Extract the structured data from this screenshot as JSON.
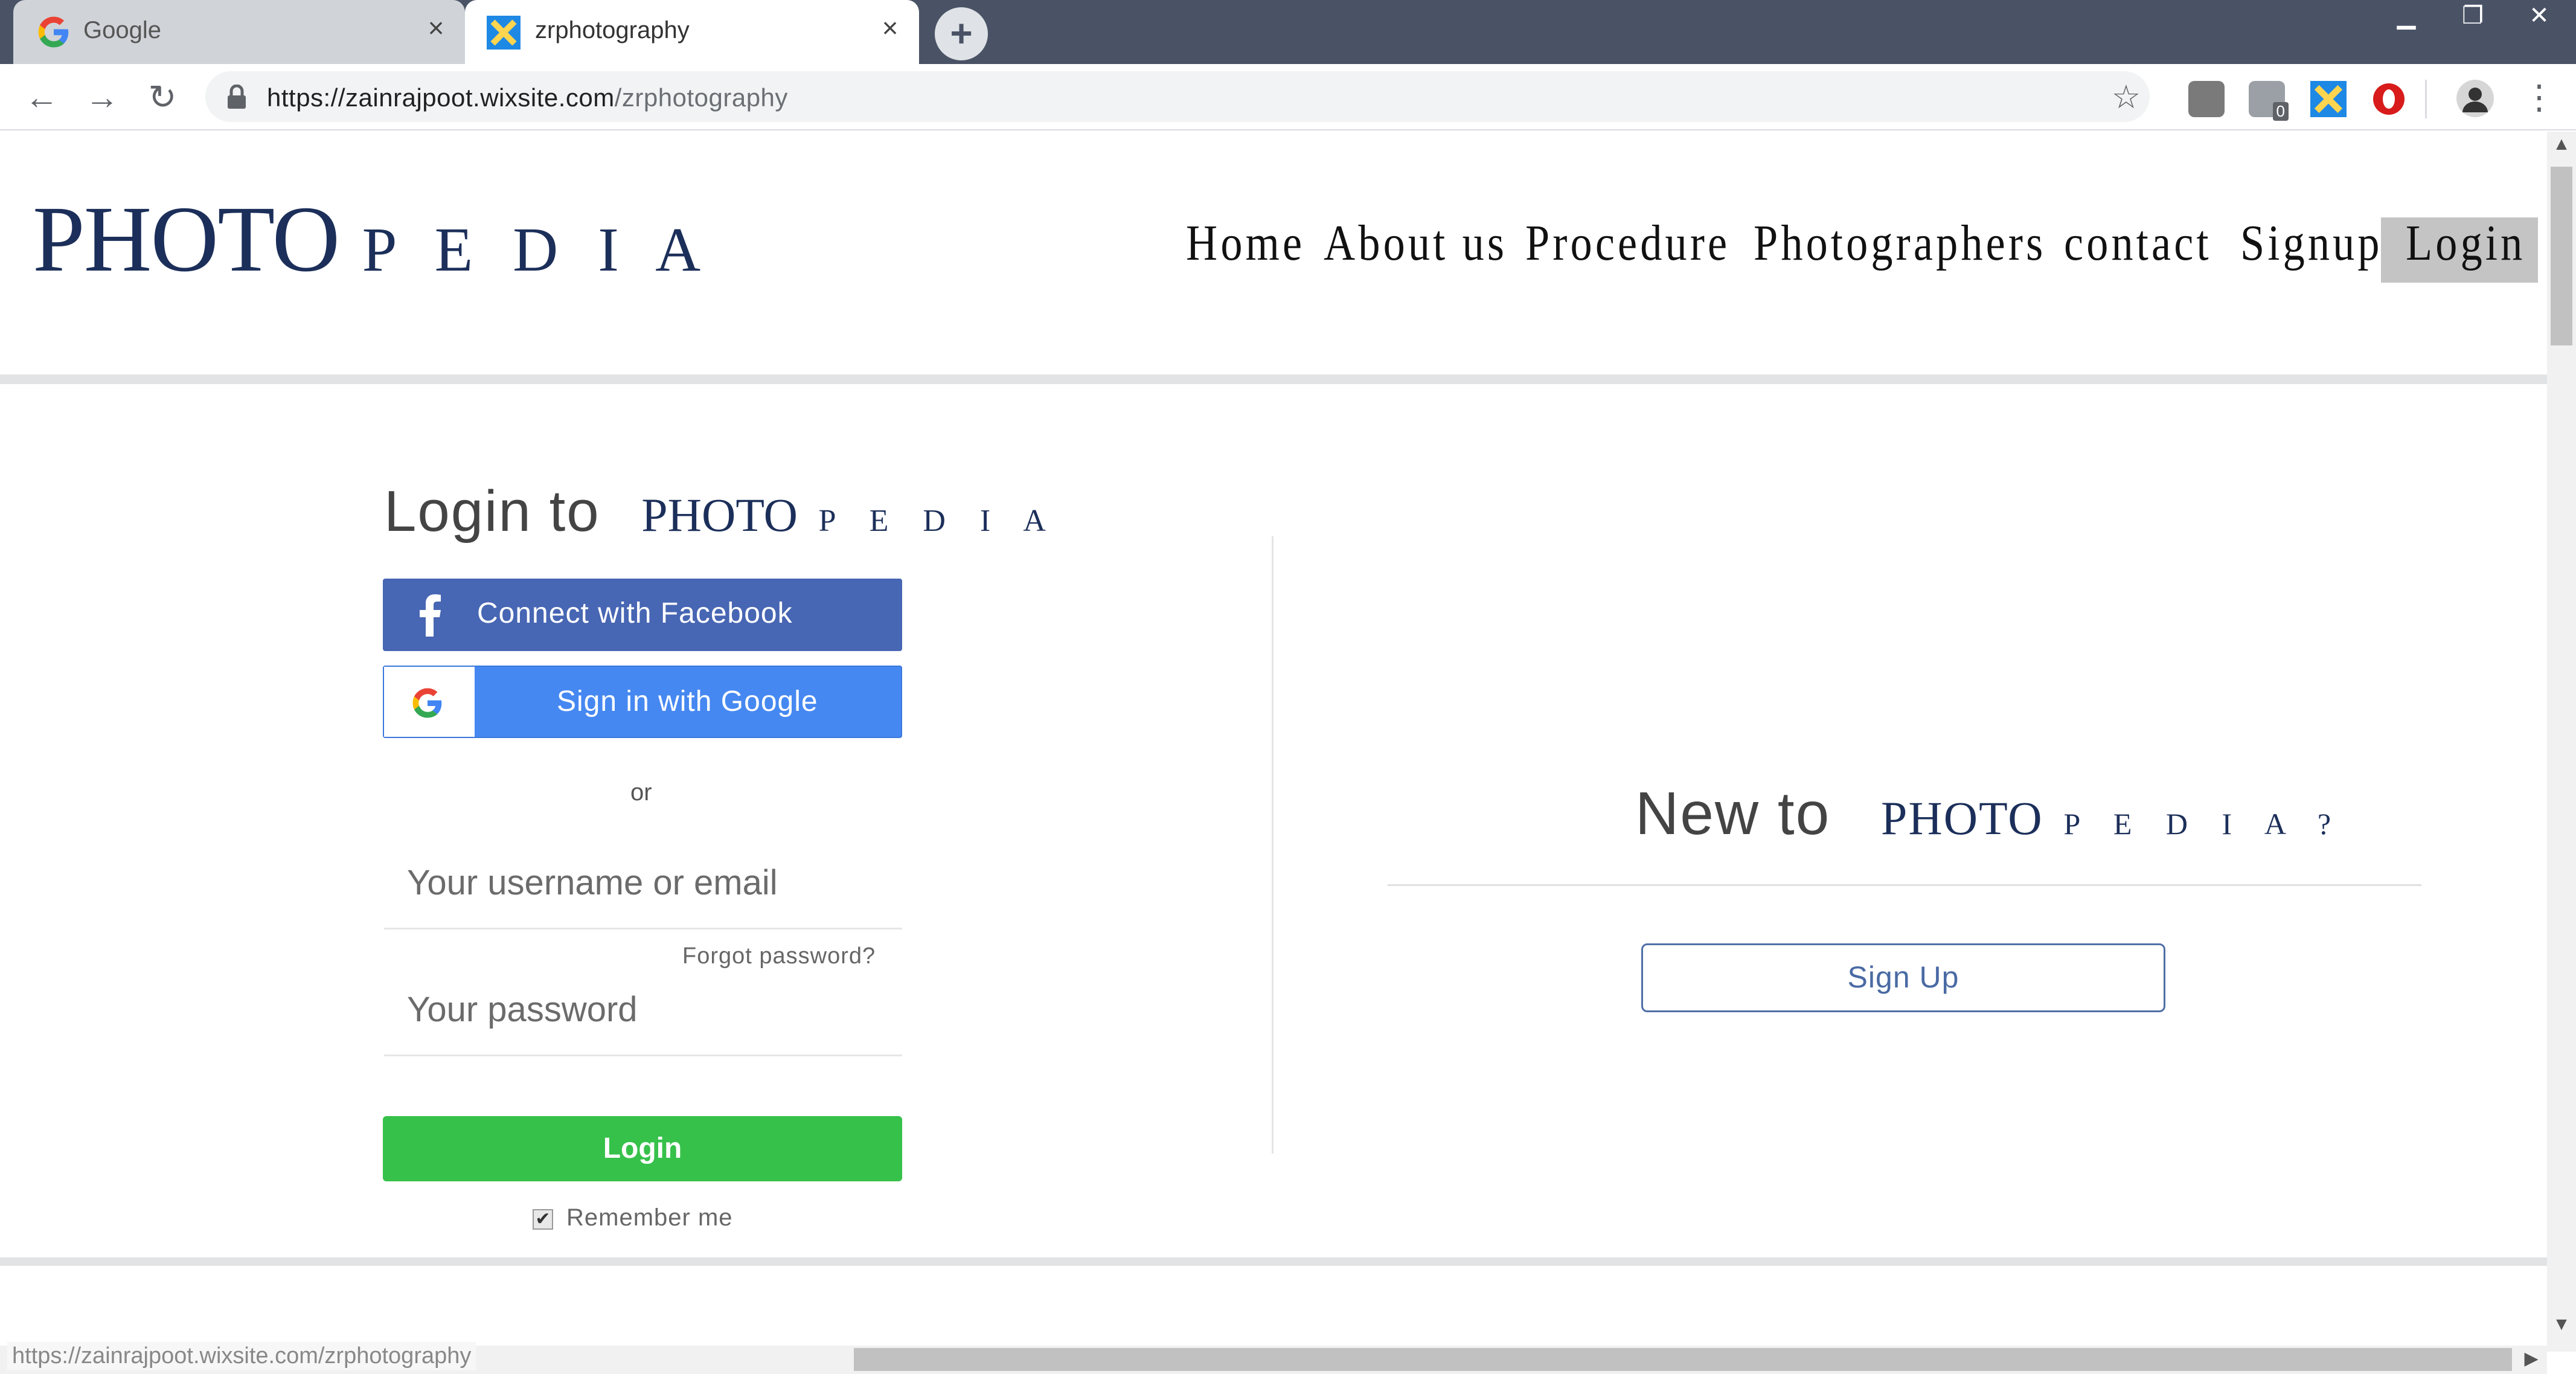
{
  "browser": {
    "tabs": [
      {
        "title": "Google",
        "active": false
      },
      {
        "title": "zrphotography",
        "active": true
      }
    ],
    "url_host": "https://zainrajpoot.wixsite.com",
    "url_path": "/zrphotography",
    "status_url": "https://zainrajpoot.wixsite.com/zrphotography",
    "extension_badge": "0"
  },
  "site": {
    "logo_photo": "PHOTO",
    "logo_pedia": "P E D I A",
    "nav": [
      "Home",
      "About us",
      "Procedure",
      "Photographers",
      "contact",
      "Signup",
      "Login"
    ]
  },
  "login": {
    "heading_prefix": "Login to",
    "facebook_label": "Connect with Facebook",
    "google_label": "Sign in with Google",
    "or_text": "or",
    "username_placeholder": "Your username or email",
    "password_placeholder": "Your password",
    "forgot_label": "Forgot password?",
    "login_button": "Login",
    "remember_label": "Remember me"
  },
  "signup": {
    "heading_prefix": "New to",
    "question_mark": "?",
    "button_label": "Sign Up"
  },
  "colors": {
    "brand_navy": "#1c2f5a",
    "facebook_blue": "#4766b3",
    "google_blue": "#4688f1",
    "login_green": "#36c14a",
    "signup_border": "#4f6fa6"
  }
}
